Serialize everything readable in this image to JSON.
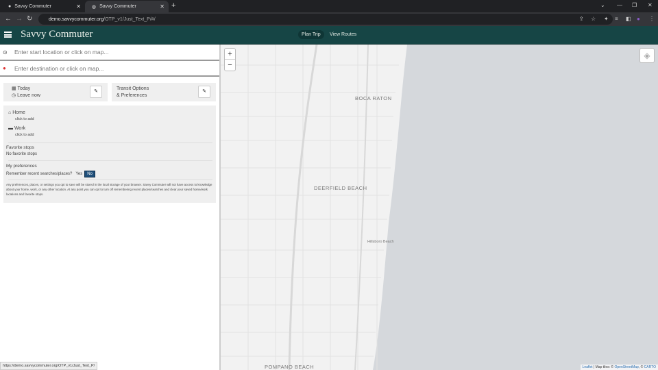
{
  "browser": {
    "tabs": [
      {
        "title": "Savvy Commuter"
      },
      {
        "title": "Savvy Commuter"
      }
    ],
    "url_host": "demo.savvycommuter.org",
    "url_path": "/OTP_v1/Just_Text_P/#/",
    "status_url": "https://demo.savvycommuter.org/OTP_v1/Just_Text_P/"
  },
  "app": {
    "brand": "Savvy Commuter",
    "nav": [
      {
        "label": "Plan Trip"
      },
      {
        "label": "View Routes"
      }
    ]
  },
  "search": {
    "start_placeholder": "Enter start location or click on map...",
    "dest_placeholder": "Enter destination or click on map..."
  },
  "when": {
    "day": "Today",
    "time": "Leave now"
  },
  "options": {
    "line1": "Transit Options",
    "line2": "& Preferences"
  },
  "saved": {
    "home": {
      "label": "Home",
      "sub": "click to add"
    },
    "work": {
      "label": "Work",
      "sub": "click to add"
    },
    "fav_title": "Favorite stops",
    "fav_empty": "No favorite stops",
    "pref_title": "My preferences",
    "remember_label": "Remember recent searches/places?",
    "yes": "Yes",
    "no": "No",
    "disclaimer": "Any preferences, places, or settings you opt to save will be stored in the local storage of your browser. Savvy Commuter will not have access to knowledge about your home, work, or any other location. At any point you can opt to turn off remembering recent places/searches and clear your saved home/work locations and favorite stops."
  },
  "map": {
    "labels": [
      "BOCA RATON",
      "DEERFIELD BEACH",
      "Hillsboro Beach",
      "POMPANO BEACH"
    ],
    "zoom_in": "+",
    "zoom_out": "−",
    "attr_leaflet": "Leaflet",
    "attr_mid": " | Map tiles: © ",
    "attr_osm": "OpenStreetMap",
    "attr_sep": ", © ",
    "attr_carto": "CARTO",
    "land_color": "#f2f2f2",
    "water_color": "#d5d8dc"
  }
}
